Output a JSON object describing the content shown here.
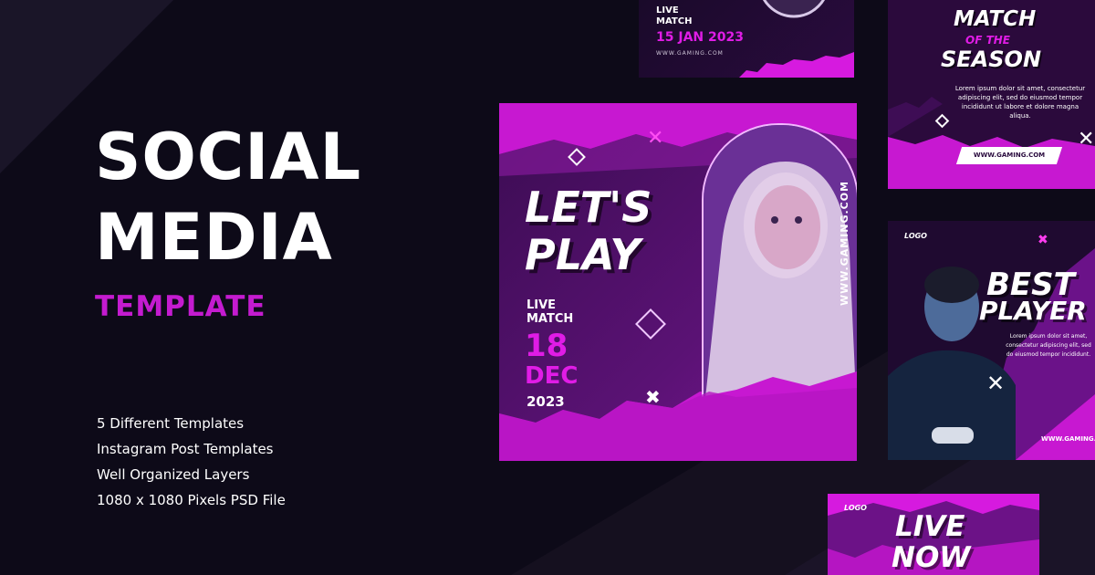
{
  "hero": {
    "title_line1": "SOCIAL",
    "title_line2": "MEDIA",
    "subtitle": "TEMPLATE"
  },
  "features": [
    "5 Different Templates",
    "Instagram Post Templates",
    "Well Organized Layers",
    "1080 x 1080 Pixels PSD File"
  ],
  "main_card": {
    "headline_line1": "LET'S",
    "headline_line2": "PLAY",
    "live_line1": "LIVE",
    "live_line2": "MATCH",
    "day": "18",
    "month": "DEC",
    "year": "2023",
    "url": "WWW.GAMING.COM"
  },
  "top_card": {
    "live_line1": "LIVE",
    "live_line2": "MATCH",
    "date": "15 JAN 2023",
    "url": "WWW.GAMING.COM"
  },
  "match_card": {
    "title_line1": "MATCH",
    "title_line2": "OF THE",
    "title_line3": "SEASON",
    "body": "Lorem ipsum dolor sit amet, consectetur adipiscing elit, sed do eiusmod tempor incididunt ut labore et dolore magna aliqua.",
    "button": "WWW.GAMING.COM"
  },
  "best_card": {
    "logo": "LOGO",
    "title_line1": "BEST",
    "title_line2": "PLAYER",
    "body": "Lorem ipsum dolor sit amet, consectetur adipiscing elit, sed do eiusmod tempor incididunt.",
    "url": "WWW.GAMING.COM"
  },
  "livenow_card": {
    "logo": "LOGO",
    "title_line1": "LIVE",
    "title_line2": "NOW"
  },
  "colors": {
    "background": "#0d0a18",
    "accent": "#c41bd0",
    "magenta": "#e01ce6"
  }
}
